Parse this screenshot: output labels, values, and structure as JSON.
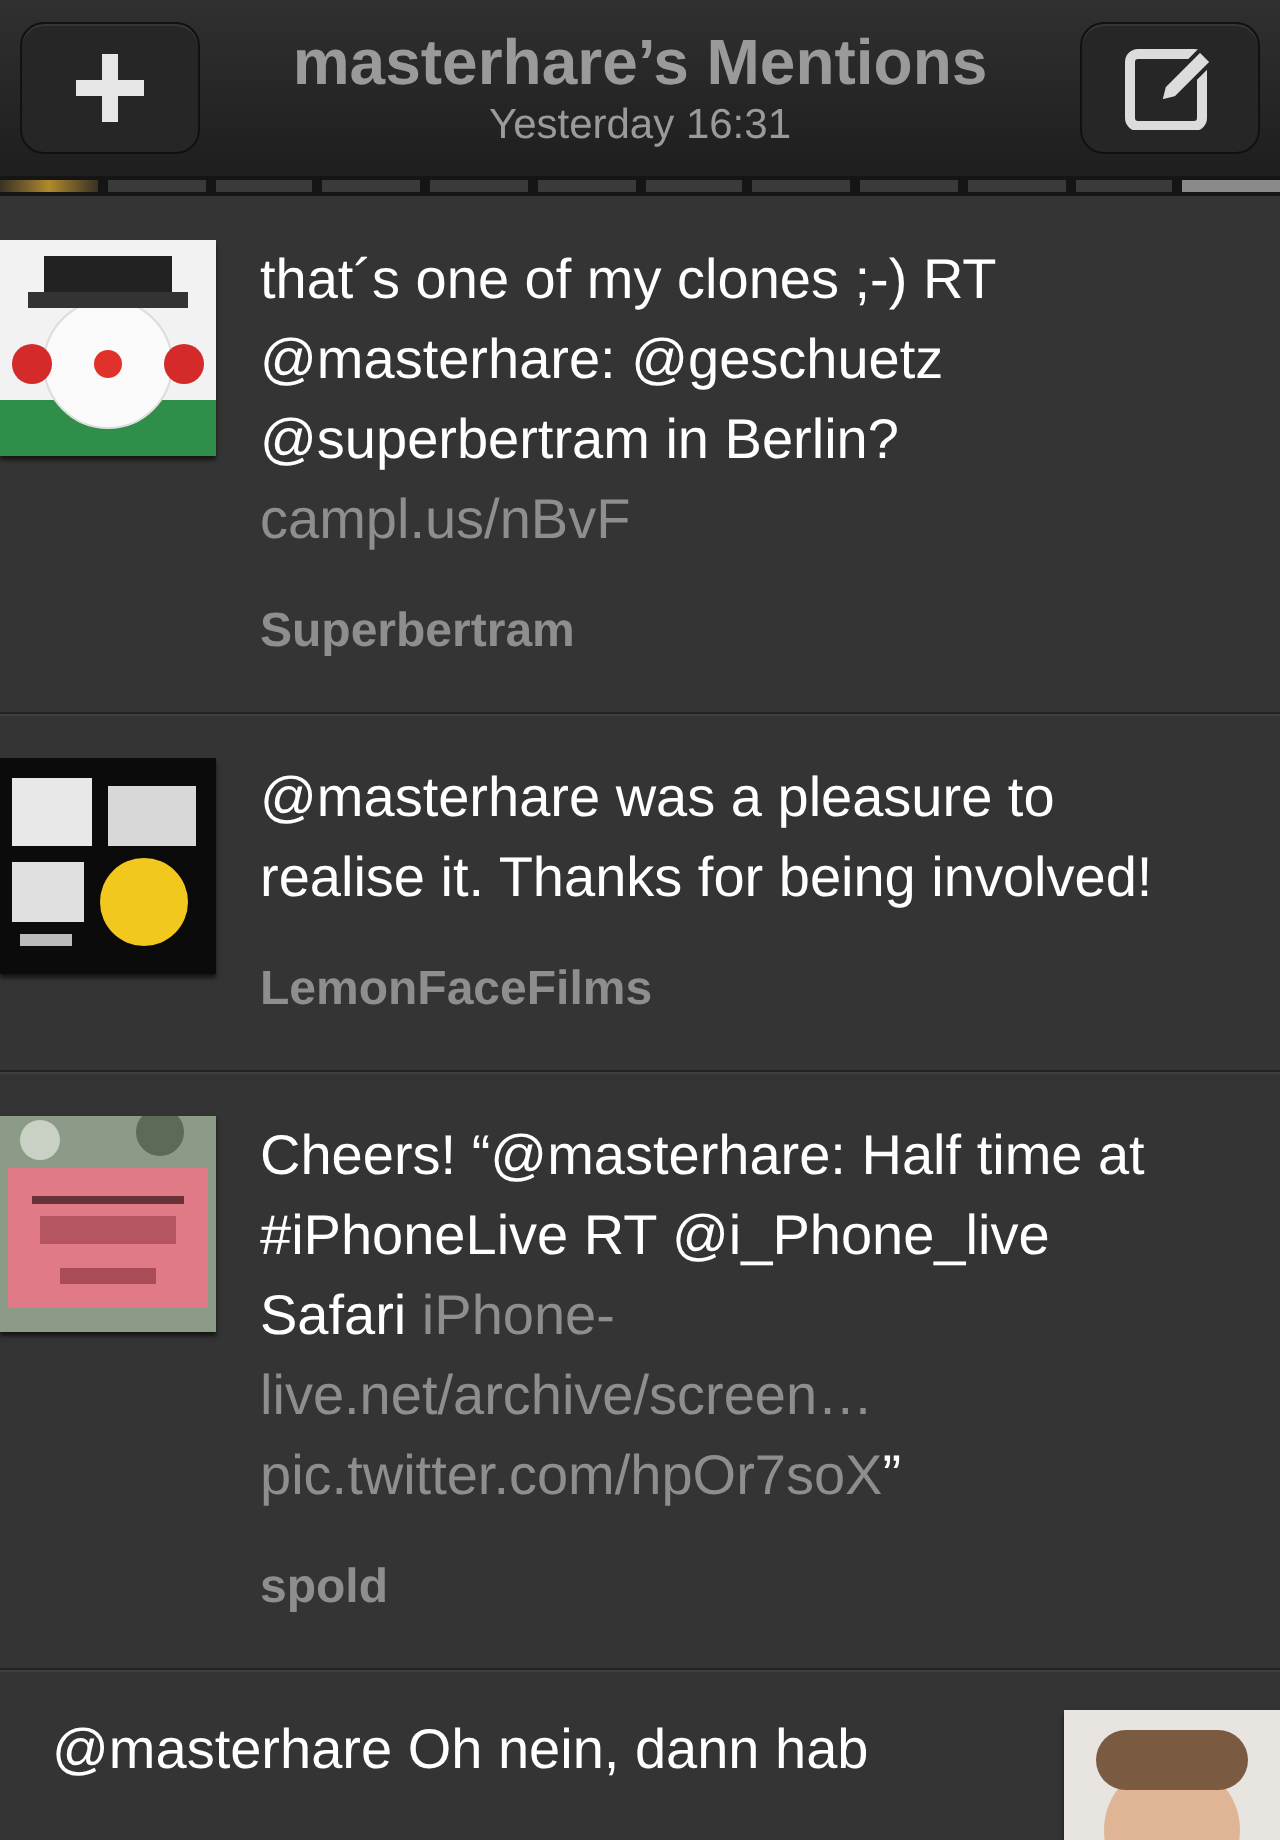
{
  "header": {
    "title": "masterhare’s Mentions",
    "subtitle": "Yesterday 16:31"
  },
  "pages": [
    {
      "selected": false,
      "unread": true
    },
    {
      "selected": false,
      "unread": false
    },
    {
      "selected": false,
      "unread": false
    },
    {
      "selected": false,
      "unread": false
    },
    {
      "selected": false,
      "unread": false
    },
    {
      "selected": false,
      "unread": false
    },
    {
      "selected": false,
      "unread": false
    },
    {
      "selected": false,
      "unread": false
    },
    {
      "selected": false,
      "unread": false
    },
    {
      "selected": false,
      "unread": false
    },
    {
      "selected": false,
      "unread": false
    },
    {
      "selected": true,
      "unread": false
    }
  ],
  "tweets": [
    {
      "kind": "incoming",
      "segments": [
        {
          "kind": "text",
          "text": "that´s one of my clones ;-) RT @masterhare: @geschuetz @superbertram in Berlin?"
        },
        {
          "kind": "link",
          "text": "campl.us/nBvF"
        }
      ],
      "author": "Superbertram"
    },
    {
      "kind": "incoming",
      "segments": [
        {
          "kind": "text",
          "text": "@masterhare was a pleasure to realise it. Thanks for being involved!"
        }
      ],
      "author": "LemonFaceFilms"
    },
    {
      "kind": "incoming",
      "segments": [
        {
          "kind": "text",
          "text": "Cheers! “@masterhare: Half time at #iPhoneLive RT @i_Phone_live Safari"
        },
        {
          "kind": "link",
          "text": "iPhone-live.net/archive/screen… pic.twitter.com/hpOr7soX"
        },
        {
          "kind": "text",
          "text": "”"
        }
      ],
      "author": "spold"
    },
    {
      "kind": "outgoing",
      "segments": [
        {
          "kind": "text",
          "text": "@masterhare Oh nein, dann hab"
        }
      ]
    }
  ]
}
